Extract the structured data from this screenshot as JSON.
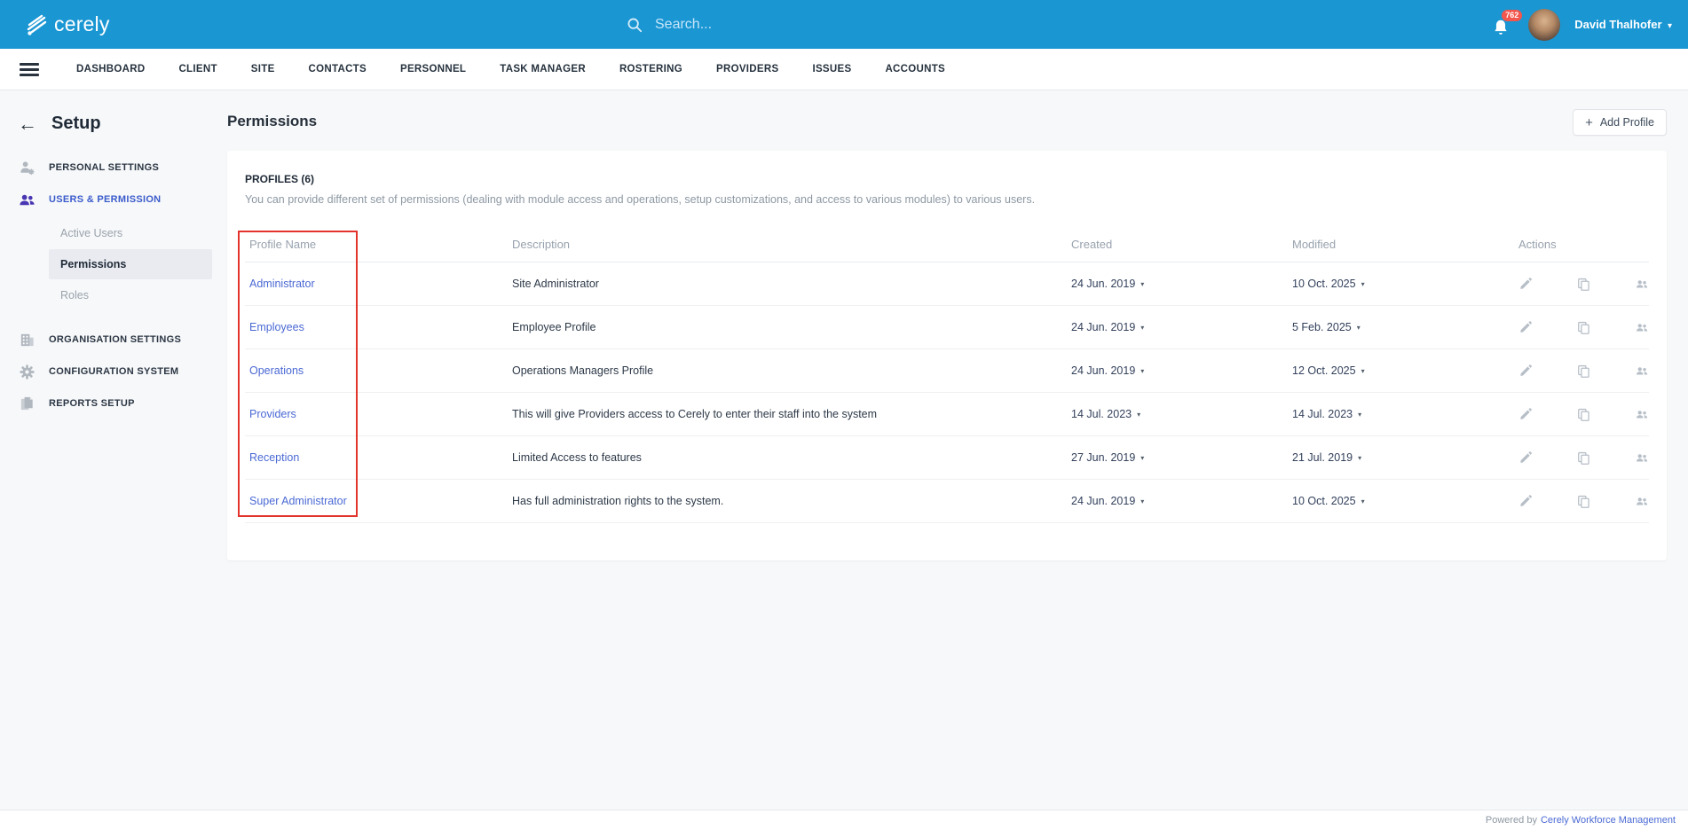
{
  "header": {
    "brand": "cerely",
    "search_placeholder": "Search...",
    "notification_count": "762",
    "user_name": "David Thalhofer"
  },
  "nav": {
    "items": [
      "DASHBOARD",
      "CLIENT",
      "SITE",
      "CONTACTS",
      "PERSONNEL",
      "TASK MANAGER",
      "ROSTERING",
      "PROVIDERS",
      "ISSUES",
      "ACCOUNTS"
    ]
  },
  "sidebar": {
    "title": "Setup",
    "personal_settings": "PERSONAL SETTINGS",
    "users_permission": "USERS & PERMISSION",
    "active_users": "Active Users",
    "permissions": "Permissions",
    "roles": "Roles",
    "organisation_settings": "ORGANISATION SETTINGS",
    "configuration_system": "CONFIGURATION SYSTEM",
    "reports_setup": "REPORTS SETUP"
  },
  "main": {
    "title": "Permissions",
    "add_profile_label": "Add Profile",
    "card": {
      "heading": "PROFILES (6)",
      "description": "You can provide different set of permissions (dealing with module access and operations, setup customizations, and access to various modules) to various users."
    },
    "table": {
      "headers": [
        "Profile Name",
        "Description",
        "Created",
        "Modified",
        "Actions"
      ],
      "rows": [
        {
          "name": "Administrator",
          "description": "Site Administrator",
          "created": "24 Jun. 2019",
          "modified": "10 Oct. 2025"
        },
        {
          "name": "Employees",
          "description": "Employee Profile",
          "created": "24 Jun. 2019",
          "modified": "5 Feb. 2025"
        },
        {
          "name": "Operations",
          "description": "Operations Managers Profile",
          "created": "24 Jun. 2019",
          "modified": "12 Oct. 2025"
        },
        {
          "name": "Providers",
          "description": "This will give Providers access to Cerely to enter their staff into the system",
          "created": "14 Jul. 2023",
          "modified": "14 Jul. 2023"
        },
        {
          "name": "Reception",
          "description": "Limited Access to features",
          "created": "27 Jun. 2019",
          "modified": "21 Jul. 2019"
        },
        {
          "name": "Super Administrator",
          "description": "Has full administration rights to the system.",
          "created": "24 Jun. 2019",
          "modified": "10 Oct. 2025"
        }
      ]
    }
  },
  "footer": {
    "powered_by": "Powered by",
    "link": "Cerely Workforce Management"
  },
  "icons": {
    "caret_down": "▾",
    "plus": "+",
    "back_arrow": "←"
  },
  "colors": {
    "header_blue": "#1a96d3",
    "badge_red": "#f2564d",
    "link_blue": "#4a69d4",
    "sidebar_active_blue": "#3b5ccc",
    "highlight_red": "#e3342c"
  }
}
